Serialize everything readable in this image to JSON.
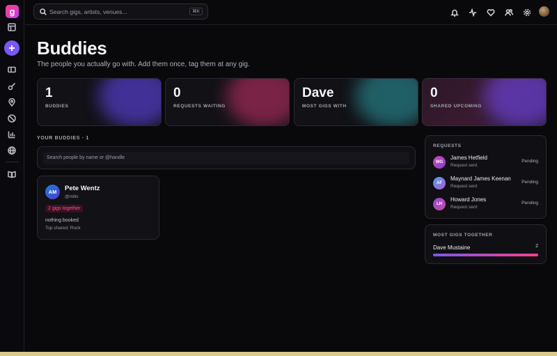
{
  "app": {
    "logo_letter": "g"
  },
  "search": {
    "placeholder": "Search gigs, artists, venues...",
    "shortcut": "⌘K"
  },
  "page": {
    "title": "Buddies",
    "subtitle": "The people you actually go with. Add them once, tag them at any gig."
  },
  "stats": [
    {
      "value": "1",
      "label": "BUDDIES",
      "glow": "#6a4cff"
    },
    {
      "value": "0",
      "label": "REQUESTS WAITING",
      "glow": "#d0336e"
    },
    {
      "value": "Dave",
      "label": "MOST GIGS WITH",
      "glow": "#2ea0a8"
    },
    {
      "value": "0",
      "label": "SHARED UPCOMING",
      "glow": "#7a4cff"
    }
  ],
  "buddies_section": {
    "label": "YOUR BUDDIES · 1",
    "search_placeholder": "Search people by name or @handle"
  },
  "buddy": {
    "initials": "AM",
    "name": "Pete Wentz",
    "handle": "@mills",
    "together": "2 gigs together",
    "booked": "nothing booked",
    "top_shared": "Top shared: Rock"
  },
  "requests": {
    "title": "REQUESTS",
    "items": [
      {
        "initials": "WG",
        "name": "James Hetfield",
        "sub": "Request sent",
        "status": "Pending",
        "color": "#b24bd6"
      },
      {
        "initials": "AF",
        "name": "Maynard James Keenan",
        "sub": "Request sent",
        "status": "Pending",
        "color": "#5a8ce8"
      },
      {
        "initials": "LH",
        "name": "Howard Jones",
        "sub": "Request sent",
        "status": "Pending",
        "color": "#a84bd0"
      }
    ]
  },
  "most_gigs": {
    "title": "MOST GIGS TOGETHER",
    "name": "Dave Mustaine",
    "count": "2",
    "fraction": 1.0
  },
  "colors": {
    "accent": "#7b57f5",
    "pink": "#ff3d8a",
    "background": "#09090c"
  }
}
